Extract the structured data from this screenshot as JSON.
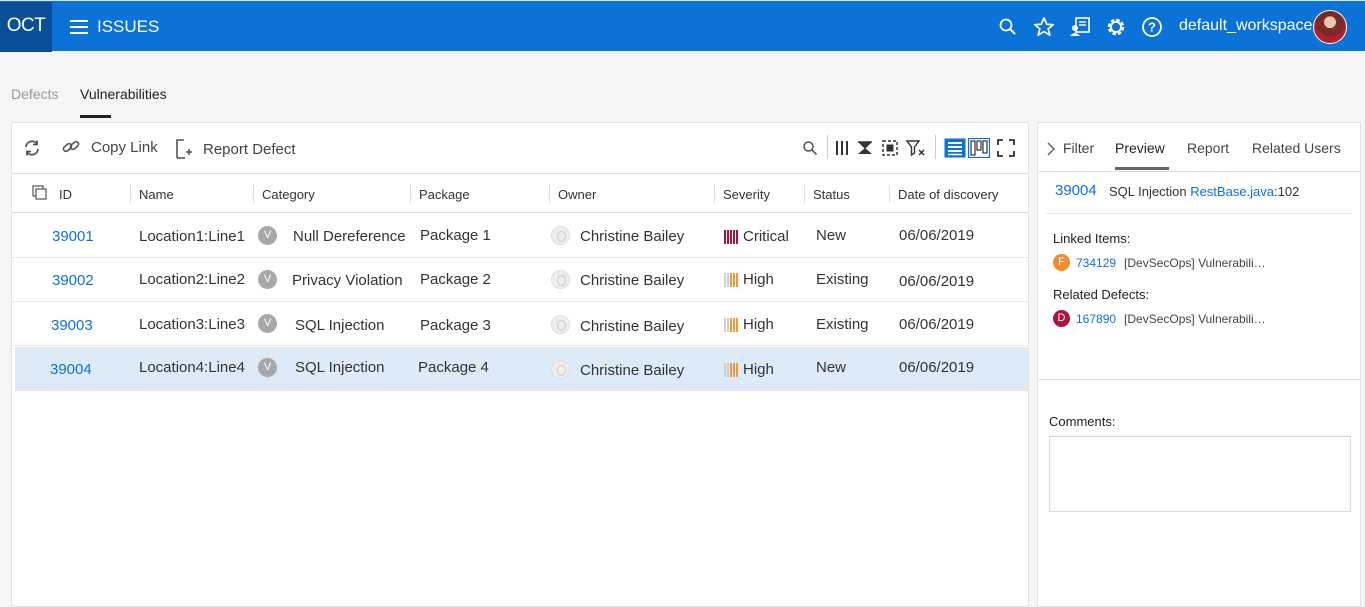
{
  "header": {
    "logo": "OCT",
    "menu_label": "ISSUES",
    "workspace": "default_workspace"
  },
  "tabs": [
    {
      "label": "Defects",
      "active": false
    },
    {
      "label": "Vulnerabilities",
      "active": true
    }
  ],
  "toolbar": {
    "copy_link": "Copy Link",
    "report_defect": "Report Defect"
  },
  "table": {
    "columns": [
      "ID",
      "Name",
      "Category",
      "Package",
      "Owner",
      "Severity",
      "Status",
      "Date of discovery"
    ],
    "rows": [
      {
        "id": "39001",
        "name": "Location1:Line1",
        "category_badge": "V",
        "category": "Null Dereference",
        "package": "Package 1",
        "owner": "Christine Bailey",
        "severity": "Critical",
        "status": "New",
        "date": "06/06/2019"
      },
      {
        "id": "39002",
        "name": "Location2:Line2",
        "category_badge": "V",
        "category": "Privacy Violation",
        "package": "Package 2",
        "owner": "Christine Bailey",
        "severity": "High",
        "status": "Existing",
        "date": "06/06/2019"
      },
      {
        "id": "39003",
        "name": "Location3:Line3",
        "category_badge": "V",
        "category": "SQL Injection",
        "package": "Package 3",
        "owner": "Christine Bailey",
        "severity": "High",
        "status": "Existing",
        "date": "06/06/2019"
      },
      {
        "id": "39004",
        "name": "Location4:Line4",
        "category_badge": "V",
        "category": "SQL Injection",
        "package": "Package 4",
        "owner": "Christine Bailey",
        "severity": "High",
        "status": "New",
        "date": "06/06/2019"
      }
    ]
  },
  "side_panel": {
    "tabs": [
      "Filter",
      "Preview",
      "Report",
      "Related Users"
    ],
    "preview": {
      "id": "39004",
      "title": "SQL Injection",
      "file": "RestBase.java",
      "line": ":102"
    },
    "linked_label": "Linked Items:",
    "linked_items": [
      {
        "badge": "F",
        "id": "734129",
        "text": "[DevSecOps] Vulnerabili…"
      }
    ],
    "related_label": "Related Defects:",
    "related_defects": [
      {
        "badge": "D",
        "id": "167890",
        "text": "[DevSecOps] Vulnerabili…"
      }
    ],
    "comments_label": "Comments:"
  },
  "colors": {
    "header_blue": "#0b72d8",
    "logo_bg": "#0a4f97",
    "critical": "#a0163c",
    "high": "#f29a3a",
    "feature_badge": "#f28a2e",
    "defect_badge": "#b0123a"
  }
}
